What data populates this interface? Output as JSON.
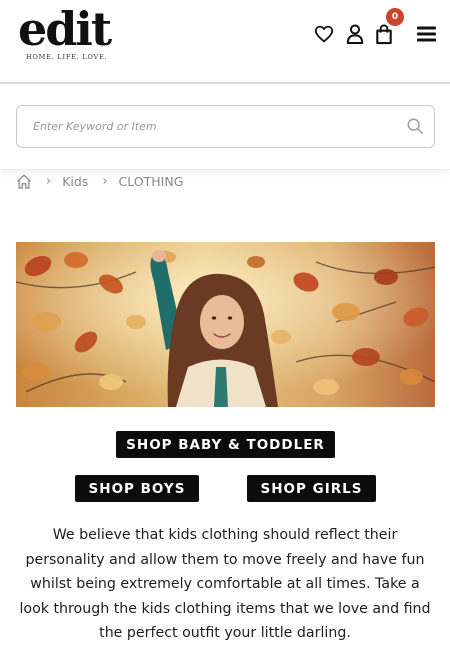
{
  "header": {
    "logo_text": "edit",
    "logo_tagline": "HOME. LIFE. LOVE.",
    "cart_count": "0",
    "icons": [
      "heart-icon",
      "user-icon",
      "shopping-bag-icon",
      "hamburger-menu-icon"
    ]
  },
  "search": {
    "placeholder": "Enter Keyword or Item",
    "value": ""
  },
  "breadcrumb": {
    "items": [
      "Kids",
      "CLOTHING"
    ]
  },
  "hero": {
    "alt": "Girl among autumn leaves"
  },
  "buttons": {
    "baby": "SHOP BABY & TODDLER",
    "boys": "SHOP BOYS",
    "girls": "SHOP GIRLS"
  },
  "intro_text": "We believe that kids clothing should reflect their personality and allow them to move freely and have fun whilst being extremely comfortable at all times. Take a look through the kids clothing items that we love and find the perfect outfit your little darling.",
  "colors": {
    "badge": "#c9452f",
    "button": "#0c0c0c"
  }
}
